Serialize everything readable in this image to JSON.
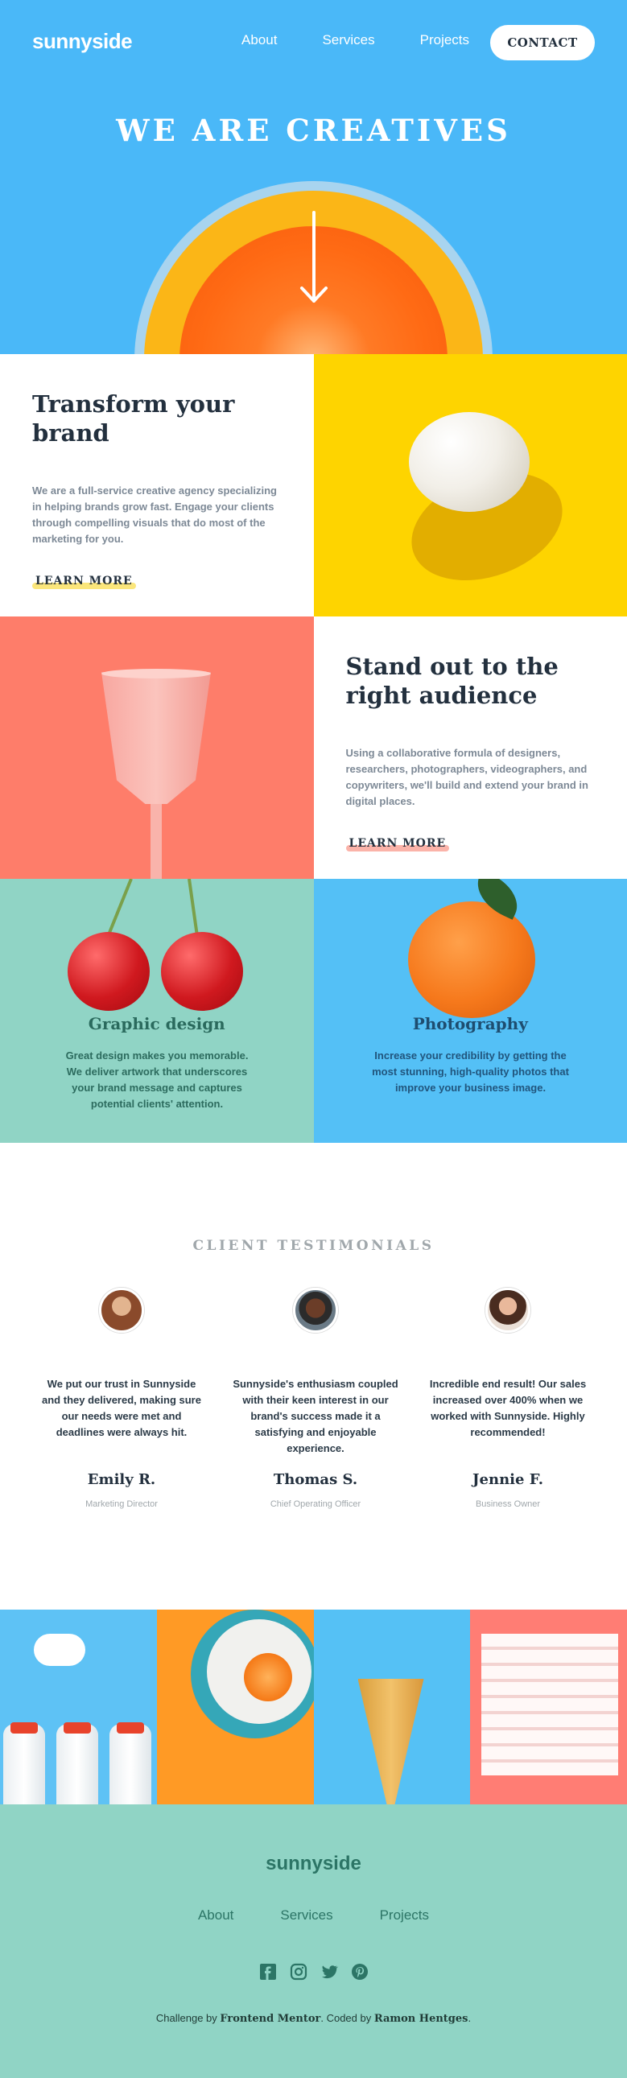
{
  "brand": "sunnyside",
  "nav": {
    "about": "About",
    "services": "Services",
    "projects": "Projects",
    "contact": "CONTACT"
  },
  "hero": {
    "title": "WE ARE CREATIVES"
  },
  "transform": {
    "heading": "Transform your brand",
    "body": "We are a full-service creative agency specializing in helping brands grow fast. Engage your clients through compelling visuals that do most of the marketing for you.",
    "link": "LEARN MORE"
  },
  "standout": {
    "heading": "Stand out to the right audience",
    "body": "Using a collaborative formula of designers, researchers, photographers, videographers, and copywriters, we'll build and extend your brand in digital places.",
    "link": "LEARN MORE"
  },
  "services": [
    {
      "title": "Graphic design",
      "body": "Great design makes you memorable. We deliver artwork that underscores your brand message and captures potential clients' attention."
    },
    {
      "title": "Photography",
      "body": "Increase your credibility by getting the most stunning, high-quality photos that improve your business image."
    }
  ],
  "testimonials": {
    "heading": "CLIENT TESTIMONIALS",
    "items": [
      {
        "quote": "We put our trust in Sunnyside and they delivered, making sure our needs were met and deadlines were always hit.",
        "name": "Emily R.",
        "role": "Marketing Director"
      },
      {
        "quote": "Sunnyside's enthusiasm coupled with their keen interest in our brand's success made it a satisfying and enjoyable experience.",
        "name": "Thomas S.",
        "role": "Chief Operating Officer"
      },
      {
        "quote": "Incredible end result! Our sales increased over 400% when we worked with Sunnyside. Highly recommended!",
        "name": "Jennie F.",
        "role": "Business Owner"
      }
    ]
  },
  "footer": {
    "brand": "sunnyside",
    "nav": [
      "About",
      "Services",
      "Projects"
    ],
    "socials": [
      "facebook-icon",
      "instagram-icon",
      "twitter-icon",
      "pinterest-icon"
    ],
    "credit_prefix": "Challenge by ",
    "credit_fm": "Frontend Mentor",
    "credit_mid": ". Coded by ",
    "credit_author": "Ramon Hentges",
    "credit_end": "."
  },
  "colors": {
    "sky": "#4ab8f8",
    "yellow": "#fed400",
    "coral": "#fe7d6a",
    "mint": "#90d4c5",
    "dark": "#23303e",
    "link_yellow": "#fbe67b",
    "link_coral": "#fbb3a9"
  }
}
